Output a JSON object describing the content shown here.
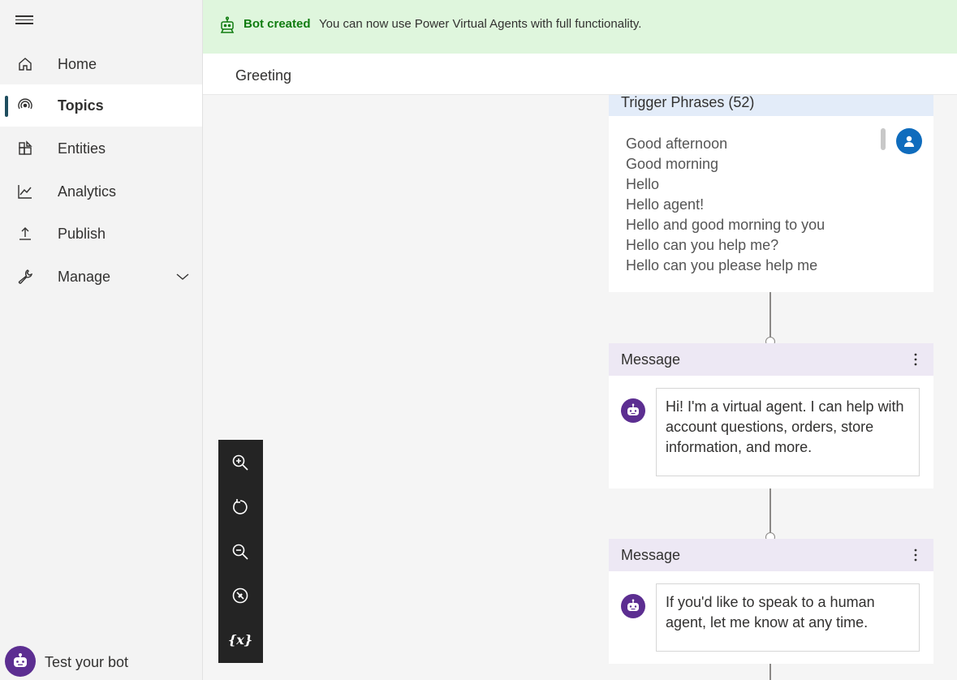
{
  "banner": {
    "title": "Bot created",
    "message": "You can now use Power Virtual Agents with full functionality.",
    "color": "#dff6dd",
    "accent": "#107c10"
  },
  "sidebar": {
    "items": [
      {
        "label": "Home",
        "icon": "home-icon"
      },
      {
        "label": "Topics",
        "icon": "topics-icon",
        "active": true
      },
      {
        "label": "Entities",
        "icon": "entities-icon"
      },
      {
        "label": "Analytics",
        "icon": "analytics-icon"
      },
      {
        "label": "Publish",
        "icon": "publish-icon"
      },
      {
        "label": "Manage",
        "icon": "wrench-icon",
        "expandable": true
      }
    ],
    "test_bot_label": "Test your bot"
  },
  "header": {
    "title": "Greeting"
  },
  "trigger": {
    "title": "Trigger Phrases (52)",
    "phrases": [
      "Good afternoon",
      "Good morning",
      "Hello",
      "Hello agent!",
      "Hello and good morning to you",
      "Hello can you help me?",
      "Hello can you please help me"
    ]
  },
  "messages": [
    {
      "title": "Message",
      "text": "Hi! I'm a virtual agent. I can help with account questions, orders, store information, and more."
    },
    {
      "title": "Message",
      "text": "If you'd like to speak to a human agent, let me know at any time."
    }
  ],
  "toolbar": {
    "variables_label": "{x}",
    "tools": [
      "zoom-in-icon",
      "reset-icon",
      "zoom-out-icon",
      "fit-to-screen-icon",
      "variables-icon"
    ]
  }
}
